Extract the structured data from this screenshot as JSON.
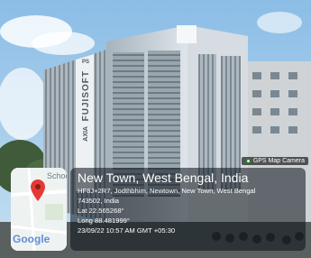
{
  "badge": {
    "label": "GPS Map Camera",
    "icon": "pin-icon"
  },
  "map": {
    "poi_label": "Schoo",
    "brand": "Google",
    "pin_color": "#e53935"
  },
  "info": {
    "place": "New Town, West Bengal, India",
    "address_1": "HF8J+2R7, Jodthbhim, Newtown, New Town, West Bengal",
    "address_2": "743502, India",
    "lat": "Lat 22.565268°",
    "long": "Long 88.481999°",
    "datetime": "23/09/22 10:57 AM GMT +05:30"
  },
  "building_sign": {
    "top": "PS",
    "brand": "FUJISOFT",
    "bottom": "AXIA"
  }
}
